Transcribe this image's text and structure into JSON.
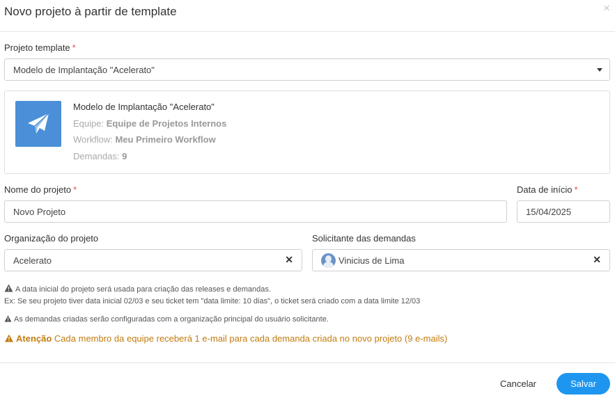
{
  "dialog": {
    "title": "Novo projeto à partir de template",
    "close_label": "×"
  },
  "template_field": {
    "label": "Projeto template",
    "required_mark": "*",
    "value": "Modelo de Implantação \"Acelerato\""
  },
  "template_card": {
    "icon": "paper-plane-icon",
    "name": "Modelo de Implantação \"Acelerato\"",
    "team_label": "Equipe:",
    "team_value": "Equipe de Projetos Internos",
    "workflow_label": "Workflow:",
    "workflow_value": "Meu Primeiro Workflow",
    "demands_label": "Demandas:",
    "demands_value": "9"
  },
  "project_name": {
    "label": "Nome do projeto",
    "required_mark": "*",
    "value": "Novo Projeto"
  },
  "start_date": {
    "label": "Data de início",
    "required_mark": "*",
    "value": "15/04/2025"
  },
  "organization": {
    "label": "Organização do projeto",
    "value": "Acelerato",
    "clear_label": "✕"
  },
  "requester": {
    "label": "Solicitante das demandas",
    "value": "Vinicius de Lima",
    "clear_label": "✕"
  },
  "notes": {
    "note1_line1": "A data inicial do projeto será usada para criação das releases e demandas.",
    "note1_line2": "Ex: Se seu projeto tiver data inicial 02/03 e seu ticket tem \"data limite: 10 dias\", o ticket será criado com a data limite 12/03",
    "note2": "As demandas criadas serão configuradas com a organização principal do usuário solicitante.",
    "attention_label": "Atenção",
    "attention_text": "Cada membro da equipe receberá 1 e-mail para cada demanda criada no novo projeto (9 e-mails)"
  },
  "footer": {
    "cancel_label": "Cancelar",
    "save_label": "Salvar"
  },
  "colors": {
    "primary": "#1e96f0",
    "template_icon_bg": "#4a8fd8",
    "required": "#d9534f",
    "warning": "#c27c0e"
  }
}
